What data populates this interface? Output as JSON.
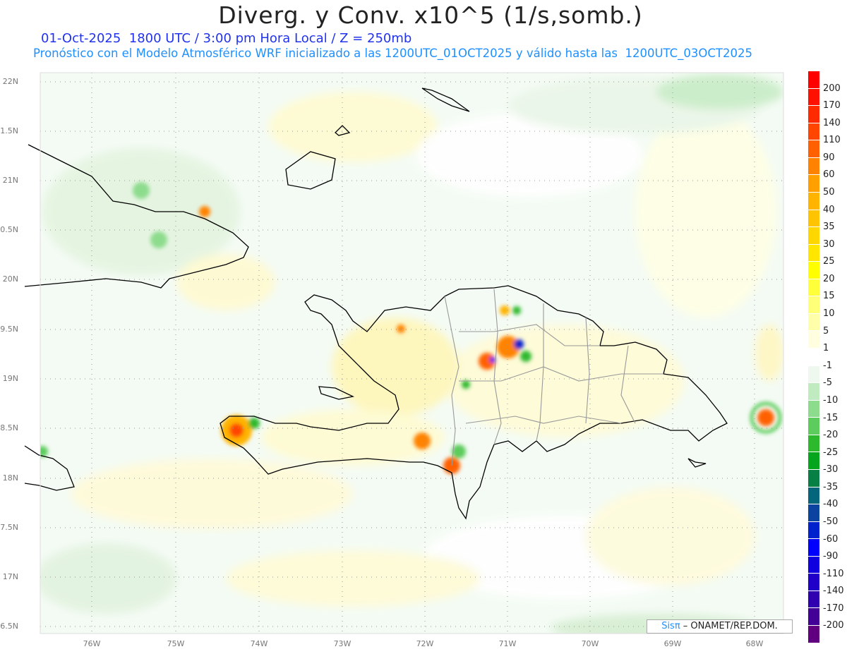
{
  "header": {
    "title": "Diverg. y Conv. x10^5 (1/s,somb.)",
    "subtitle1": "01-Oct-2025  1800 UTC / 3:00 pm Hora Local / Z = 250mb",
    "subtitle2": "Pronóstico con el Modelo Atmosférico WRF inicializado a las 1200UTC_01OCT2025 y válido hasta las  1200UTC_03OCT2025"
  },
  "map": {
    "lat_labels": [
      "22N",
      "1.5N",
      "21N",
      "0.5N",
      "20N",
      "9.5N",
      "19N",
      "8.5N",
      "18N",
      "7.5N",
      "17N",
      "6.5N"
    ],
    "lon_labels": [
      "76W",
      "75W",
      "74W",
      "73W",
      "72W",
      "71W",
      "70W",
      "69W",
      "68W"
    ]
  },
  "colorbar": {
    "labels": [
      "200",
      "170",
      "140",
      "110",
      "90",
      "60",
      "50",
      "40",
      "35",
      "30",
      "25",
      "20",
      "15",
      "10",
      "5",
      "1",
      "-1",
      "-5",
      "-10",
      "-15",
      "-20",
      "-25",
      "-30",
      "-35",
      "-40",
      "-50",
      "-60",
      "-90",
      "-110",
      "-140",
      "-170",
      "-200"
    ],
    "colors": [
      "#ff0000",
      "#ff1000",
      "#ff2a00",
      "#ff4500",
      "#ff6000",
      "#ff8200",
      "#ffa000",
      "#ffb400",
      "#ffc400",
      "#ffd700",
      "#ffe600",
      "#ffff00",
      "#ffff3a",
      "#ffff78",
      "#ffffaa",
      "#ffffe0",
      "#ffffff",
      "#eef8ee",
      "#c0eac0",
      "#8ddc8d",
      "#5ccc5c",
      "#2db92d",
      "#05a51e",
      "#078046",
      "#05657a",
      "#0a44a0",
      "#0022cc",
      "#0000ff",
      "#1000e0",
      "#2000c8",
      "#3000b0",
      "#420096",
      "#600080"
    ]
  },
  "credit": {
    "brand": "Sisπ",
    "text": " – ONAMET/REP.DOM."
  }
}
